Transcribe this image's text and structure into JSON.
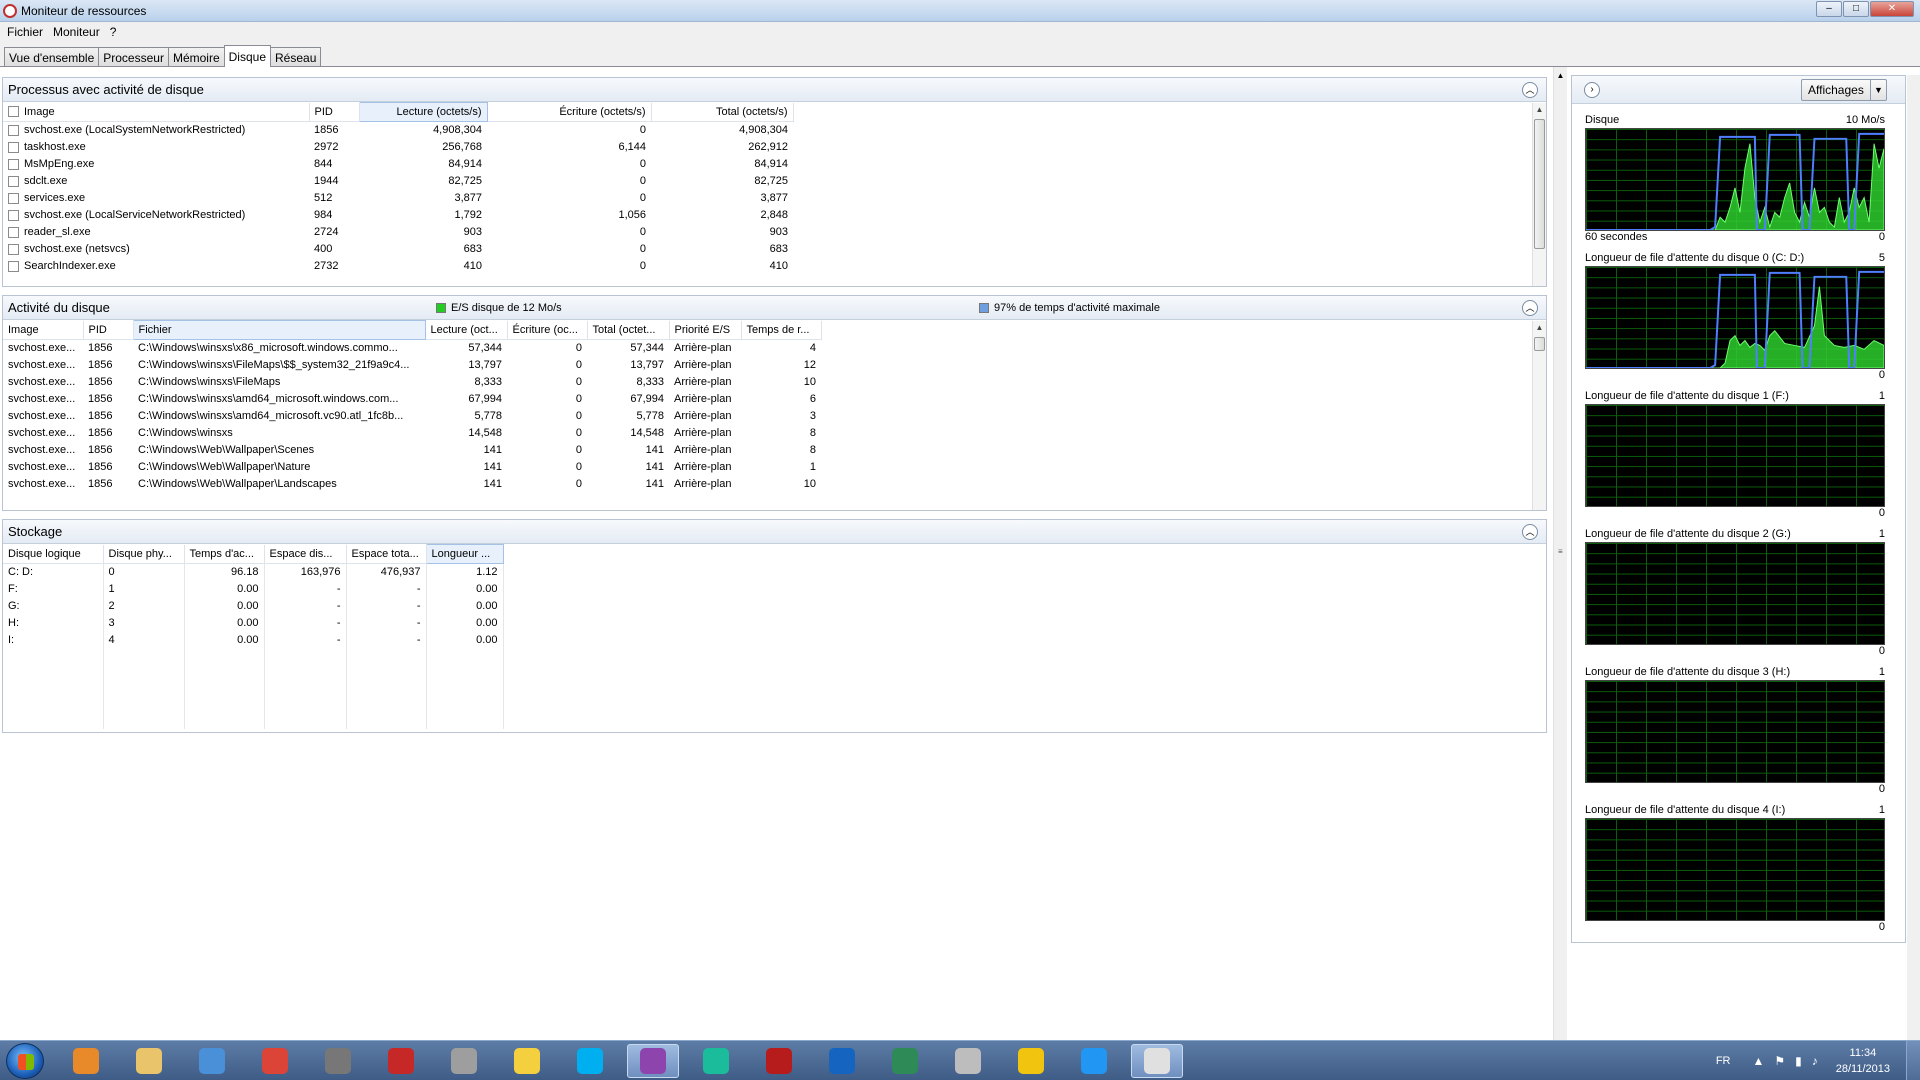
{
  "window": {
    "title": "Moniteur de ressources"
  },
  "menu": [
    "Fichier",
    "Moniteur",
    "?"
  ],
  "tabs": [
    {
      "label": "Vue d'ensemble",
      "active": false
    },
    {
      "label": "Processeur",
      "active": false
    },
    {
      "label": "Mémoire",
      "active": false
    },
    {
      "label": "Disque",
      "active": true
    },
    {
      "label": "Réseau",
      "active": false
    }
  ],
  "processes": {
    "title": "Processus avec activité de disque",
    "columns": [
      "Image",
      "PID",
      "Lecture (octets/s)",
      "Écriture (octets/s)",
      "Total (octets/s)"
    ],
    "rows": [
      [
        "svchost.exe (LocalSystemNetworkRestricted)",
        "1856",
        "4,908,304",
        "0",
        "4,908,304"
      ],
      [
        "taskhost.exe",
        "2972",
        "256,768",
        "6,144",
        "262,912"
      ],
      [
        "MsMpEng.exe",
        "844",
        "84,914",
        "0",
        "84,914"
      ],
      [
        "sdclt.exe",
        "1944",
        "82,725",
        "0",
        "82,725"
      ],
      [
        "services.exe",
        "512",
        "3,877",
        "0",
        "3,877"
      ],
      [
        "svchost.exe (LocalServiceNetworkRestricted)",
        "984",
        "1,792",
        "1,056",
        "2,848"
      ],
      [
        "reader_sl.exe",
        "2724",
        "903",
        "0",
        "903"
      ],
      [
        "svchost.exe (netsvcs)",
        "400",
        "683",
        "0",
        "683"
      ],
      [
        "SearchIndexer.exe",
        "2732",
        "410",
        "0",
        "410"
      ]
    ]
  },
  "activity": {
    "title": "Activité du disque",
    "legend_io": "E/S disque de 12 Mo/s",
    "legend_active": "97% de temps d'activité maximale",
    "legend_io_color": "#22cc22",
    "legend_active_color": "#6f9fe0",
    "columns": [
      "Image",
      "PID",
      "Fichier",
      "Lecture (oct...",
      "Écriture (oc...",
      "Total (octet...",
      "Priorité E/S",
      "Temps de r..."
    ],
    "rows": [
      [
        "svchost.exe...",
        "1856",
        "C:\\Windows\\winsxs\\x86_microsoft.windows.commo...",
        "57,344",
        "0",
        "57,344",
        "Arrière-plan",
        "4"
      ],
      [
        "svchost.exe...",
        "1856",
        "C:\\Windows\\winsxs\\FileMaps\\$$_system32_21f9a9c4...",
        "13,797",
        "0",
        "13,797",
        "Arrière-plan",
        "12"
      ],
      [
        "svchost.exe...",
        "1856",
        "C:\\Windows\\winsxs\\FileMaps",
        "8,333",
        "0",
        "8,333",
        "Arrière-plan",
        "10"
      ],
      [
        "svchost.exe...",
        "1856",
        "C:\\Windows\\winsxs\\amd64_microsoft.windows.com...",
        "67,994",
        "0",
        "67,994",
        "Arrière-plan",
        "6"
      ],
      [
        "svchost.exe...",
        "1856",
        "C:\\Windows\\winsxs\\amd64_microsoft.vc90.atl_1fc8b...",
        "5,778",
        "0",
        "5,778",
        "Arrière-plan",
        "3"
      ],
      [
        "svchost.exe...",
        "1856",
        "C:\\Windows\\winsxs",
        "14,548",
        "0",
        "14,548",
        "Arrière-plan",
        "8"
      ],
      [
        "svchost.exe...",
        "1856",
        "C:\\Windows\\Web\\Wallpaper\\Scenes",
        "141",
        "0",
        "141",
        "Arrière-plan",
        "8"
      ],
      [
        "svchost.exe...",
        "1856",
        "C:\\Windows\\Web\\Wallpaper\\Nature",
        "141",
        "0",
        "141",
        "Arrière-plan",
        "1"
      ],
      [
        "svchost.exe...",
        "1856",
        "C:\\Windows\\Web\\Wallpaper\\Landscapes",
        "141",
        "0",
        "141",
        "Arrière-plan",
        "10"
      ]
    ]
  },
  "storage": {
    "title": "Stockage",
    "columns": [
      "Disque logique",
      "Disque phy...",
      "Temps d'ac...",
      "Espace dis...",
      "Espace tota...",
      "Longueur ..."
    ],
    "rows": [
      [
        "C: D:",
        "0",
        "96.18",
        "163,976",
        "476,937",
        "1.12"
      ],
      [
        "F:",
        "1",
        "0.00",
        "-",
        "-",
        "0.00"
      ],
      [
        "G:",
        "2",
        "0.00",
        "-",
        "-",
        "0.00"
      ],
      [
        "H:",
        "3",
        "0.00",
        "-",
        "-",
        "0.00"
      ],
      [
        "I:",
        "4",
        "0.00",
        "-",
        "-",
        "0.00"
      ]
    ]
  },
  "right_pane": {
    "views_label": "Affichages",
    "graphs": [
      {
        "label": "Disque",
        "max": "10 Mo/s",
        "foot_left": "60 secondes",
        "min": "0",
        "active": true
      },
      {
        "label": "Longueur de file d'attente du disque 0 (C: D:)",
        "max": "5",
        "foot_left": "",
        "min": "0",
        "active": true
      },
      {
        "label": "Longueur de file d'attente du disque 1 (F:)",
        "max": "1",
        "foot_left": "",
        "min": "0",
        "active": false
      },
      {
        "label": "Longueur de file d'attente du disque 2 (G:)",
        "max": "1",
        "foot_left": "",
        "min": "0",
        "active": false
      },
      {
        "label": "Longueur de file d'attente du disque 3 (H:)",
        "max": "1",
        "foot_left": "",
        "min": "0",
        "active": false
      },
      {
        "label": "Longueur de file d'attente du disque 4 (I:)",
        "max": "1",
        "foot_left": "",
        "min": "0",
        "active": false
      }
    ]
  },
  "taskbar": {
    "apps": [
      {
        "name": "media-player-icon",
        "color": "#e88a2a"
      },
      {
        "name": "explorer-icon",
        "color": "#e9c46a"
      },
      {
        "name": "itunes-icon",
        "color": "#4a90d9"
      },
      {
        "name": "chrome-icon",
        "color": "#db4437"
      },
      {
        "name": "keyboard-icon",
        "color": "#777777"
      },
      {
        "name": "speed-icon",
        "color": "#c62828"
      },
      {
        "name": "globe-icon",
        "color": "#9e9e9e"
      },
      {
        "name": "flight-icon",
        "color": "#f4d03f"
      },
      {
        "name": "skype-icon",
        "color": "#00aff0"
      },
      {
        "name": "color-app-icon",
        "color": "#8e44ad"
      },
      {
        "name": "network-app-icon",
        "color": "#1abc9c"
      },
      {
        "name": "filezilla-icon",
        "color": "#b71c1c"
      },
      {
        "name": "rex-icon",
        "color": "#1565c0"
      },
      {
        "name": "elephant-icon",
        "color": "#2e8b57"
      },
      {
        "name": "drive-icon",
        "color": "#bdbdbd"
      },
      {
        "name": "monitor-icon",
        "color": "#f1c40f"
      },
      {
        "name": "moon-icon",
        "color": "#2196f3"
      },
      {
        "name": "resource-monitor-icon",
        "color": "#e0e0e0"
      }
    ],
    "lang": "FR",
    "time": "11:34",
    "date": "28/11/2013"
  }
}
